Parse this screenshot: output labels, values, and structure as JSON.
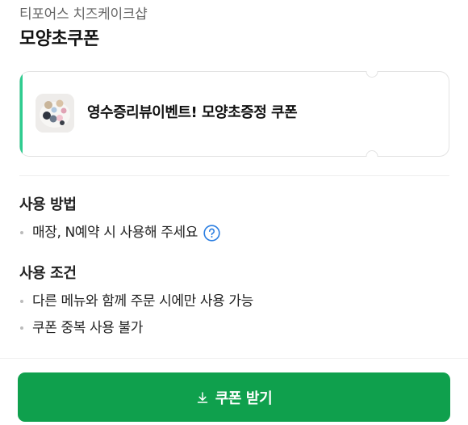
{
  "header": {
    "store_name": "티포어스 치즈케이크샵",
    "coupon_title": "모양초쿠폰"
  },
  "coupon_card": {
    "name": "영수증리뷰이벤트! 모양초증정 쿠폰",
    "accent_color": "#2ecc8f",
    "thumbnail": "product-photo"
  },
  "usage_method": {
    "heading": "사용 방법",
    "items": [
      "매장, N예약 시 사용해 주세요"
    ],
    "help_icon": "question-circle-icon"
  },
  "usage_conditions": {
    "heading": "사용 조건",
    "items": [
      "다른 메뉴와 함께 주문 시에만 사용 가능",
      "쿠폰 중복 사용 불가"
    ]
  },
  "action": {
    "button_label": "쿠폰 받기",
    "button_icon": "download-icon",
    "button_color": "#0fa04d"
  },
  "colors": {
    "help_icon": "#2a7de1",
    "text_secondary": "#666666"
  }
}
